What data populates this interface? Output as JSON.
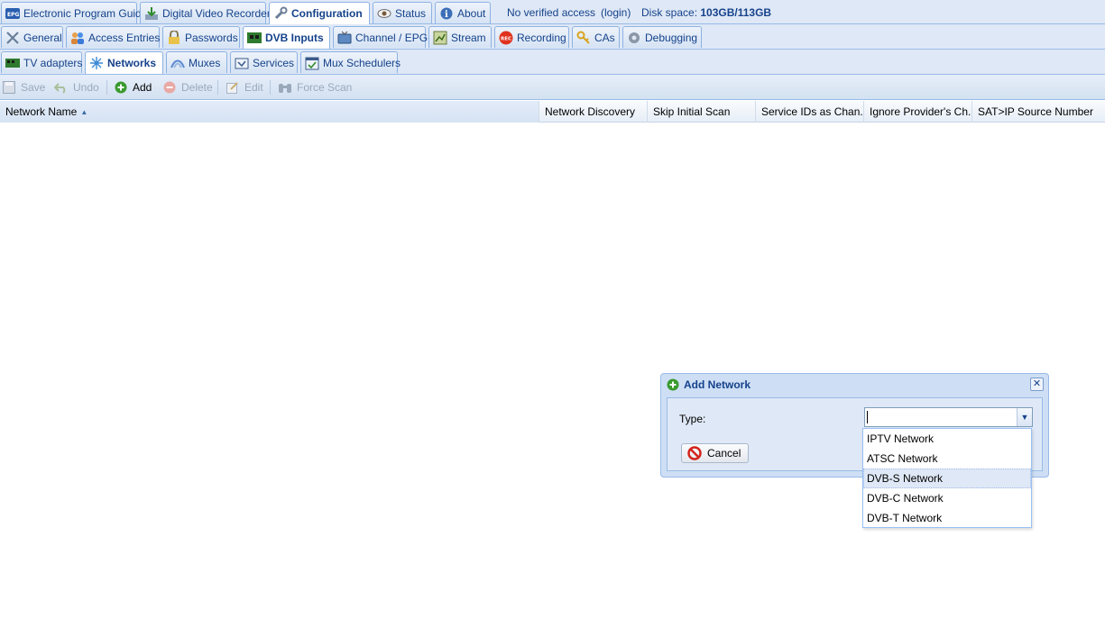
{
  "top_tabs": [
    {
      "label": "Electronic Program Guide",
      "icon": "epg-icon"
    },
    {
      "label": "Digital Video Recorder",
      "icon": "download-icon"
    },
    {
      "label": "Configuration",
      "icon": "wrench-icon",
      "active": true
    },
    {
      "label": "Status",
      "icon": "eye-icon"
    },
    {
      "label": "About",
      "icon": "info-icon"
    }
  ],
  "top_info": {
    "access": "No verified access",
    "login": "(login)",
    "disk_label": "Disk space:",
    "disk_value": "103GB/113GB"
  },
  "config_tabs": [
    {
      "label": "General",
      "icon": "tools-icon"
    },
    {
      "label": "Access Entries",
      "icon": "users-icon"
    },
    {
      "label": "Passwords",
      "icon": "lock-icon"
    },
    {
      "label": "DVB Inputs",
      "icon": "card-icon",
      "active": true
    },
    {
      "label": "Channel / EPG",
      "icon": "tv-icon"
    },
    {
      "label": "Stream",
      "icon": "stream-icon"
    },
    {
      "label": "Recording",
      "icon": "rec-icon"
    },
    {
      "label": "CAs",
      "icon": "key-icon"
    },
    {
      "label": "Debugging",
      "icon": "bug-icon"
    }
  ],
  "dvb_tabs": [
    {
      "label": "TV adapters",
      "icon": "adapter-icon"
    },
    {
      "label": "Networks",
      "icon": "network-icon",
      "active": true
    },
    {
      "label": "Muxes",
      "icon": "muxes-icon"
    },
    {
      "label": "Services",
      "icon": "services-icon"
    },
    {
      "label": "Mux Schedulers",
      "icon": "scheduler-icon"
    }
  ],
  "toolbar": {
    "save": "Save",
    "undo": "Undo",
    "add": "Add",
    "delete": "Delete",
    "edit": "Edit",
    "force_scan": "Force Scan"
  },
  "grid": {
    "columns": [
      "Network Name",
      "Network Discovery",
      "Skip Initial Scan",
      "Service IDs as Chan...",
      "Ignore Provider's Ch...",
      "SAT>IP Source Number"
    ]
  },
  "dialog": {
    "title": "Add Network",
    "type_label": "Type:",
    "type_value": "",
    "cancel": "Cancel",
    "options": [
      "IPTV Network",
      "ATSC Network",
      "DVB-S Network",
      "DVB-C Network",
      "DVB-T Network"
    ],
    "highlighted": "DVB-S Network"
  },
  "colors": {
    "header_bg": "#dfe8f6",
    "border": "#99bbe8",
    "text": "#15428b",
    "recording_red": "#e0321e",
    "add_green": "#3a9a2e"
  }
}
